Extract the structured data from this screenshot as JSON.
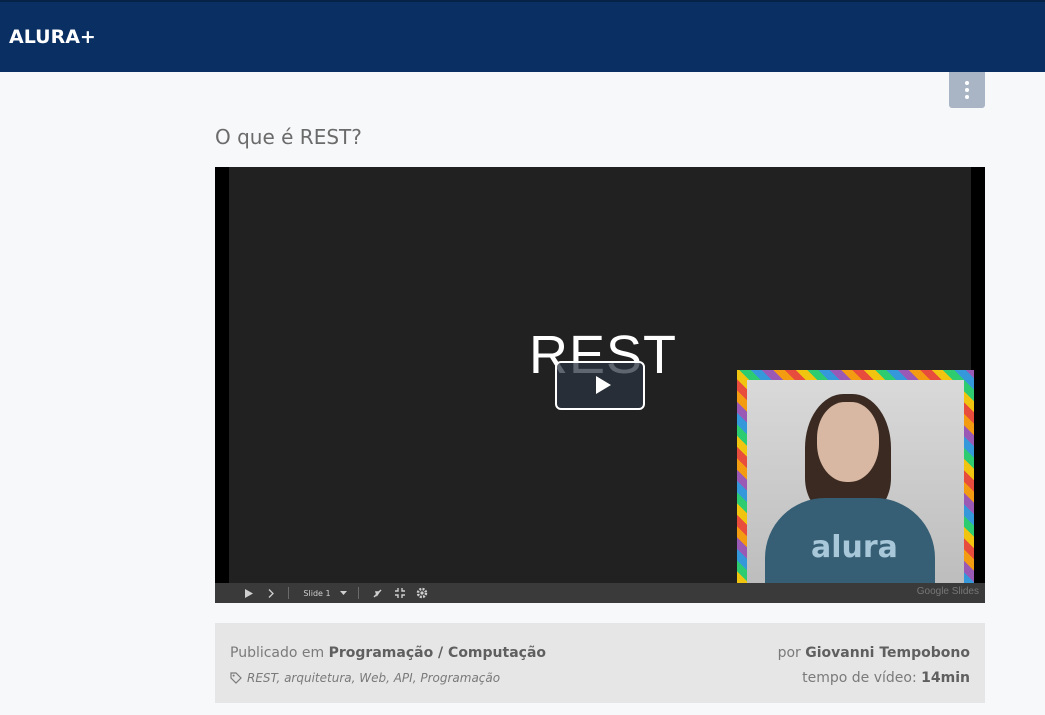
{
  "header": {
    "brand": "ALURA+"
  },
  "menu": {
    "icon": "vertical-dots-icon"
  },
  "video": {
    "title": "O que é REST?",
    "slide_text": "REST",
    "controls": {
      "slide_label": "Slide 1",
      "provider": "Google Slides"
    },
    "webcam_shirt_text": "alura",
    "is_playing": false
  },
  "info": {
    "published_prefix": "Publicado em",
    "category": "Programação / Computação",
    "tags": "REST, arquitetura, Web, API, Programação",
    "author_prefix": "por",
    "author": "Giovanni Tempobono",
    "duration_prefix": "tempo de vídeo:",
    "duration": "14min"
  },
  "colors": {
    "topbar": "#0a2f63",
    "menu_button": "#a9b5c4",
    "info_bar": "#e6e6e6"
  }
}
